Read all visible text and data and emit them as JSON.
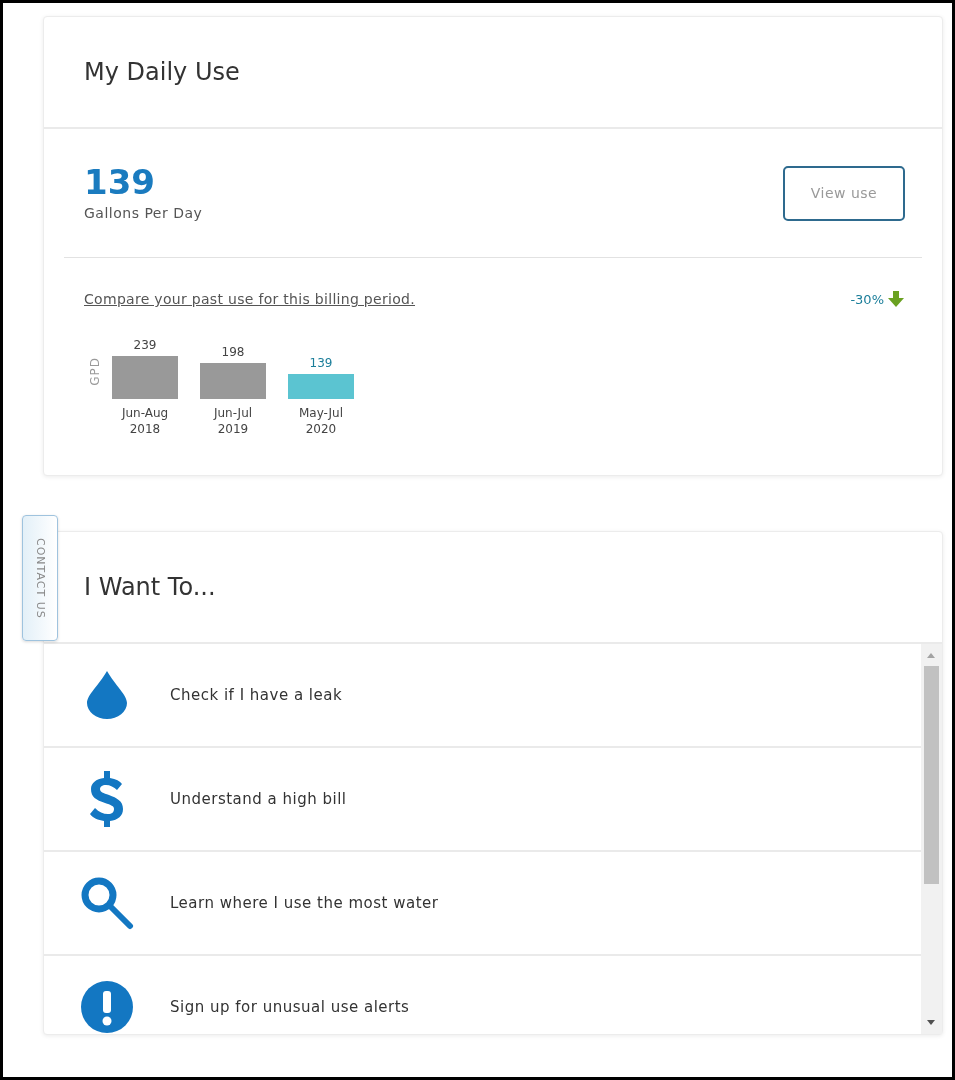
{
  "usage_card": {
    "title": "My Daily Use",
    "value": "139",
    "unit": "Gallons Per Day",
    "view_button": "View use",
    "compare_link": "Compare your past use for this billing period.",
    "change": {
      "text": "-30%",
      "kind": "down"
    },
    "chart_data": {
      "type": "bar",
      "ylabel": "GPD",
      "categories": [
        "Jun-Aug 2018",
        "Jun-Jul 2019",
        "May-Jul 2020"
      ],
      "data_labels": true,
      "series": [
        {
          "color": "#999999",
          "values": [
            239,
            198,
            null
          ]
        },
        {
          "color": "#5bc4d1",
          "values": [
            null,
            null,
            139
          ]
        }
      ]
    }
  },
  "contact_tab": {
    "label": "CONTACT US"
  },
  "actions_card": {
    "title": "I Want To...",
    "items": [
      {
        "kind": "drop",
        "label": "Check if I have a leak"
      },
      {
        "kind": "dollar",
        "label": "Understand a high bill"
      },
      {
        "kind": "search",
        "label": "Learn where I use the most water"
      },
      {
        "kind": "alert",
        "label": "Sign up for unusual use alerts"
      }
    ]
  }
}
